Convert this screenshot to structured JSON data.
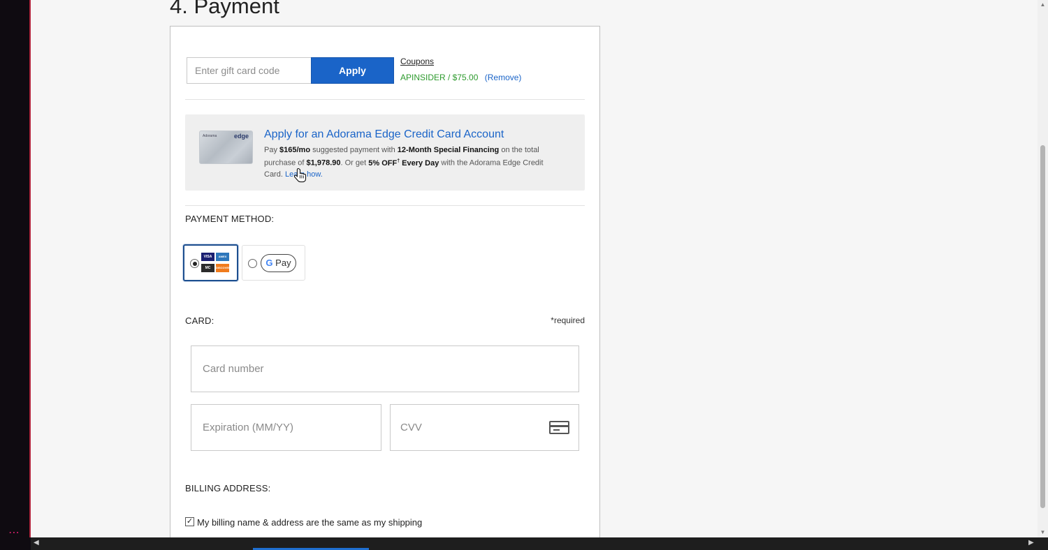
{
  "section": {
    "title": "4. Payment"
  },
  "gift_card": {
    "placeholder": "Enter gift card code",
    "apply_label": "Apply",
    "coupons_label": "Coupons",
    "applied_coupon": "APINSIDER / $75.00",
    "remove_label": "(Remove)"
  },
  "promo": {
    "card_brand": "Adorama",
    "card_edge": "edge",
    "title": "Apply for an Adorama Edge Credit Card Account",
    "text_pay": "Pay ",
    "monthly": "$165/mo",
    "text_suggested": " suggested payment with ",
    "financing": "12-Month Special Financing",
    "text_total": " on the total purchase of ",
    "total": "$1,978.90",
    "text_or": ". Or get ",
    "discount": "5% OFF",
    "dagger": "†",
    "every_day": " Every Day",
    "text_card": " with the Adorama Edge Credit Card. ",
    "learn_label": "Learn how."
  },
  "payment_method": {
    "label": "PAYMENT METHOD:",
    "options": [
      {
        "name": "credit-card",
        "selected": true,
        "logos": [
          "VISA",
          "AMEX",
          "MC",
          "DISCOVER"
        ]
      },
      {
        "name": "google-pay",
        "selected": false,
        "badge_g": "G",
        "badge_text": "Pay"
      }
    ]
  },
  "card": {
    "label": "CARD:",
    "required_note": "*required",
    "number_placeholder": "Card number",
    "expiry_placeholder": "Expiration (MM/YY)",
    "cvv_placeholder": "CVV"
  },
  "billing": {
    "label": "BILLING ADDRESS:",
    "same_as_shipping_label": "My billing name & address are the same as my shipping",
    "same_as_shipping_checked": true,
    "check_mark": "✓"
  },
  "colors": {
    "accent": "#1a64c8",
    "coupon_green": "#2d9a2d",
    "selected_border": "#1d4f8f"
  },
  "icons": {
    "cvv": "credit-card-icon",
    "cursor": "hand-pointer-icon",
    "menu": "ellipsis-icon"
  },
  "ui": {
    "dots": "⋯"
  }
}
